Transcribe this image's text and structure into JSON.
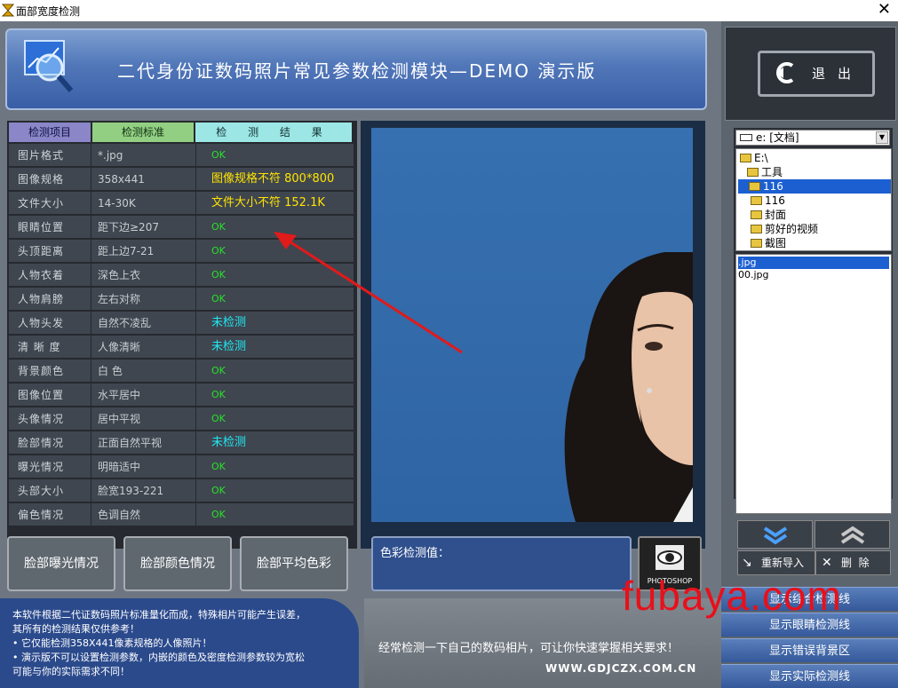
{
  "window": {
    "title": "面部宽度检测"
  },
  "header": {
    "title": "二代身份证数码照片常见参数检测模块—DEMO 演示版"
  },
  "table": {
    "headers": [
      "检测项目",
      "检测标准",
      "检 测 结 果"
    ],
    "rows": [
      {
        "item": "图片格式",
        "standard": "*.jpg",
        "result": "OK",
        "status": "ok"
      },
      {
        "item": "图像规格",
        "standard": "358x441",
        "result": "图像规格不符  800*800",
        "status": "warn"
      },
      {
        "item": "文件大小",
        "standard": "14-30K",
        "result": "文件大小不符  152.1K",
        "status": "warn"
      },
      {
        "item": "眼睛位置",
        "standard": "距下边≥207",
        "result": "OK",
        "status": "ok"
      },
      {
        "item": "头顶距离",
        "standard": "距上边7-21",
        "result": "OK",
        "status": "ok"
      },
      {
        "item": "人物衣着",
        "standard": "深色上衣",
        "result": "OK",
        "status": "ok"
      },
      {
        "item": "人物肩膀",
        "standard": "左右对称",
        "result": "OK",
        "status": "ok"
      },
      {
        "item": "人物头发",
        "standard": "自然不凌乱",
        "result": "未检测",
        "status": "unk"
      },
      {
        "item": "清 晰 度",
        "standard": "人像清晰",
        "result": "未检测",
        "status": "unk"
      },
      {
        "item": "背景颜色",
        "standard": "白   色",
        "result": "OK",
        "status": "ok"
      },
      {
        "item": "图像位置",
        "standard": "水平居中",
        "result": "OK",
        "status": "ok"
      },
      {
        "item": "头像情况",
        "standard": "居中平视",
        "result": "OK",
        "status": "ok"
      },
      {
        "item": "脸部情况",
        "standard": "正面自然平视",
        "result": "未检测",
        "status": "unk"
      },
      {
        "item": "曝光情况",
        "standard": "明暗适中",
        "result": "OK",
        "status": "ok"
      },
      {
        "item": "头部大小",
        "standard": "脸宽193-221",
        "result": "OK",
        "status": "ok"
      },
      {
        "item": "偏色情况",
        "standard": "色调自然",
        "result": "OK",
        "status": "ok"
      }
    ]
  },
  "bottom_buttons": [
    "脸部曝光情况",
    "脸部颜色情况",
    "脸部平均色彩"
  ],
  "color_panel": {
    "label": "色彩检测值：",
    "photoshop_label": "PHOTOSHOP"
  },
  "info": {
    "intro": "本软件根据二代证数码照片标准量化而成，特殊相片可能产生误差，",
    "intro2": "其所有的检测结果仅供参考！",
    "bullet1": "• 它仅能检测358X441像素规格的人像照片！",
    "bullet2": "• 演示版不可以设置检测参数，内嵌的颜色及密度检测参数较为宽松",
    "bullet3": "  可能与你的实际需求不同！"
  },
  "footer": {
    "text": "经常检测一下自己的数码相片，可让你快速掌握相关要求！",
    "url": "WWW.GDJCZX.COM.CN"
  },
  "exit": {
    "label": "退出"
  },
  "filesystem": {
    "drive": "e: [文档]",
    "dirs": [
      "E:\\",
      "工具",
      "116",
      "116",
      "封面",
      "剪好的视频",
      "截图"
    ],
    "files": [
      ".jpg",
      "00.jpg"
    ]
  },
  "right_actions": {
    "import": "重新导入",
    "delete": "删  除"
  },
  "side_buttons": [
    "显示综合检测线",
    "显示眼睛检测线",
    "显示错误背景区",
    "显示实际检测线"
  ],
  "watermark": "fubaya.com",
  "colors": {
    "ok": "#29e02a",
    "warn": "#ffe400",
    "unchecked": "#1ee8f2",
    "selection": "#1c5fd1"
  }
}
